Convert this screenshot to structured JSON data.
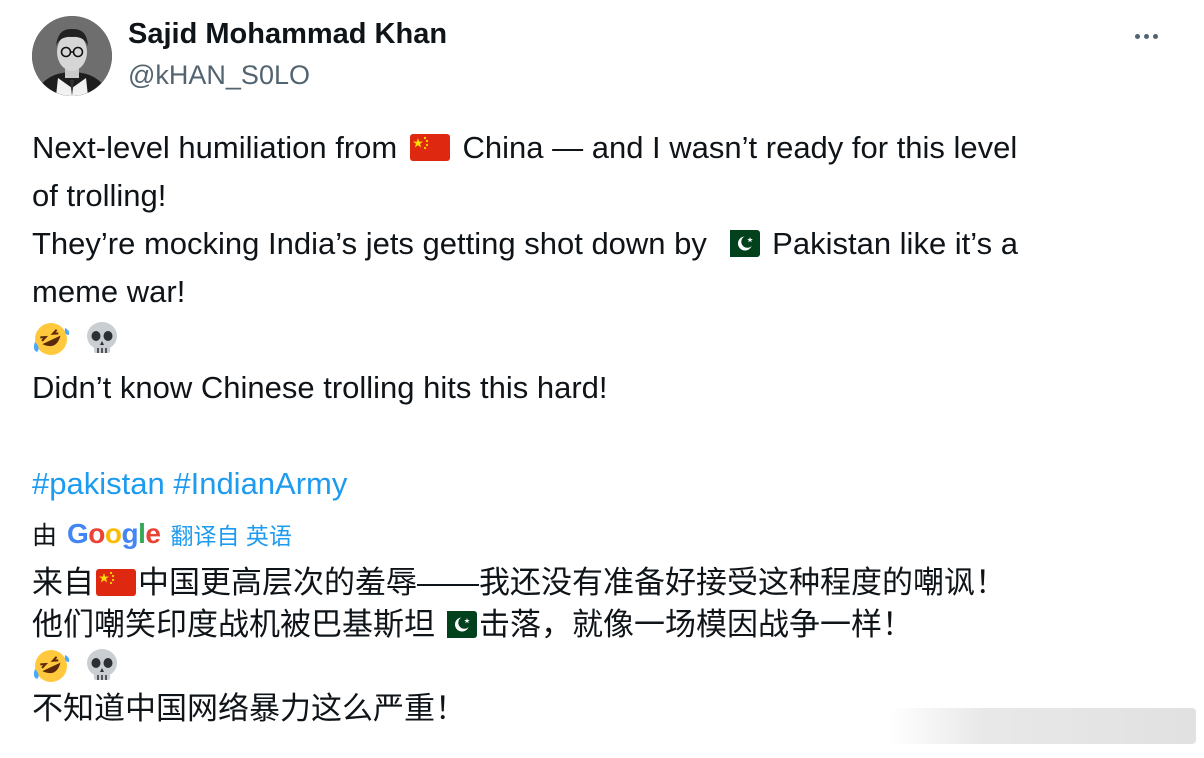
{
  "author": {
    "name": "Sajid Mohammad Khan",
    "handle": "@kHAN_S0LO"
  },
  "menu": {
    "more_icon": "more-horizontal-icon"
  },
  "tweet": {
    "line1_pre": "Next-level humiliation from",
    "line1_post": "China — and I wasn’t ready for this level",
    "line2": "of trolling!",
    "line3_pre": "They’re mocking India’s jets getting shot down by",
    "line3_post": "Pakistan like it’s a",
    "line4": "meme war!",
    "line6": "Didn’t know Chinese trolling hits this hard!",
    "emojis": [
      "rofl-emoji",
      "skull-emoji"
    ],
    "flags": [
      "china-flag",
      "pakistan-flag"
    ]
  },
  "hashtags": [
    "#pakistan",
    "#IndianArmy"
  ],
  "translation": {
    "by_label": "由",
    "provider": "Google",
    "action_label": "翻译自 英语",
    "line1_pre": "来自",
    "line1_post": "中国更高层次的羞辱——我还没有准备好接受这种程度的嘲讽！",
    "line2_pre": "他们嘲笑印度战机被巴基斯坦",
    "line2_post": "击落，就像一场模因战争一样！",
    "line4": "不知道中国网络暴力这么严重！"
  },
  "colors": {
    "link": "#1d9bf0",
    "text": "#0f1419",
    "secondary": "#536471"
  }
}
